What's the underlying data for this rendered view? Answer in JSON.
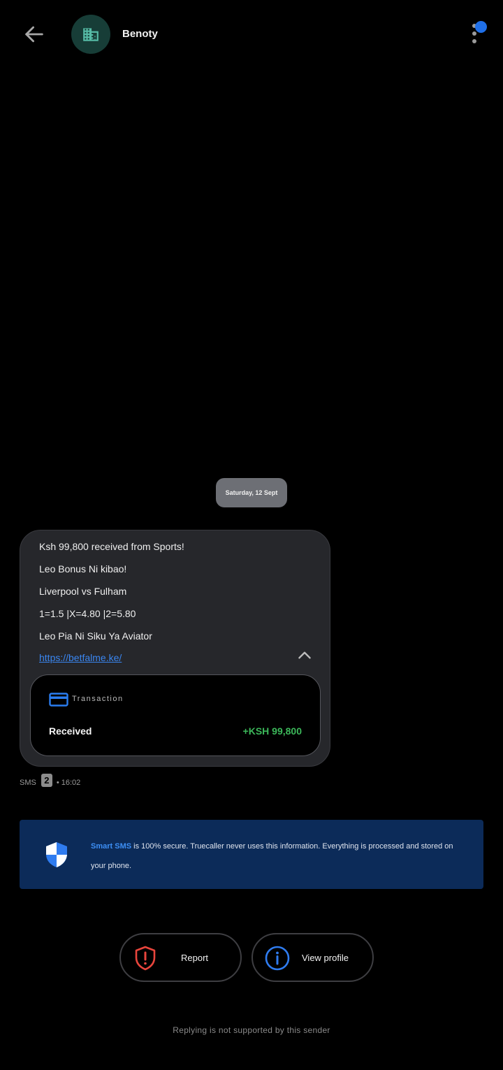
{
  "header": {
    "sender_name": "Benoty",
    "avatar_icon": "building-icon",
    "back_icon": "arrow-left-icon",
    "menu_icon": "more-vertical-icon",
    "accent_color": "#1f6fe8"
  },
  "conversation": {
    "date_label": "Saturday, 12 Sept",
    "message": {
      "lines": [
        "Ksh 99,800 received from Sports!",
        "Leo Bonus Ni kibao!",
        "Liverpool vs Fulham",
        "1=1.5 |X=4.80 |2=5.80",
        "Leo Pia Ni Siku Ya Aviator"
      ],
      "link": "https://betfalme.ke/",
      "transaction": {
        "label": "Transaction",
        "type": "Received",
        "amount": "+KSH 99,800",
        "amount_color": "#3cb85a"
      }
    },
    "meta": {
      "channel": "SMS",
      "sim": "2",
      "time": "• 16:02"
    }
  },
  "smart_sms_banner": {
    "strong_text": "Smart SMS",
    "text": " is 100% secure. Truecaller never uses this information. Everything is processed and stored on your phone."
  },
  "actions": {
    "report_label": "Report",
    "view_profile_label": "View profile"
  },
  "footer_note": "Replying is not supported by this sender"
}
